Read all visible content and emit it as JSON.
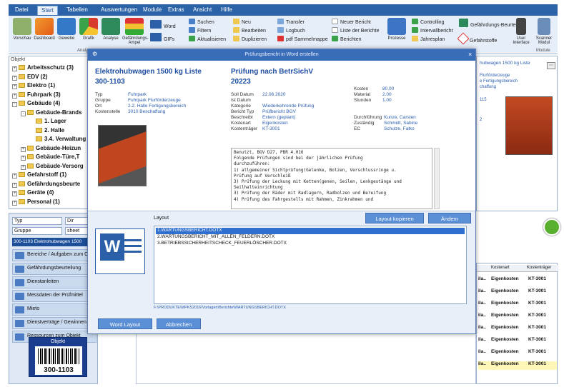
{
  "menubar": {
    "tabs": [
      "Datei",
      "Start",
      "Tabellen",
      "Auswertungen",
      "Module",
      "Extras",
      "Ansicht",
      "Hilfe"
    ],
    "active": "Start"
  },
  "ribbon": {
    "big_buttons": [
      {
        "label": "Vorschau",
        "icon": "preview-icon"
      },
      {
        "label": "Dashboard",
        "icon": "chart-icon"
      },
      {
        "label": "Gewebe",
        "icon": "network-icon"
      },
      {
        "label": "Grafik",
        "icon": "pie-icon"
      },
      {
        "label": "Analyse",
        "icon": "analyze-icon"
      },
      {
        "label": "Gefährdungs-Ampel",
        "icon": "traffic-icon"
      }
    ],
    "group_label_analysis": "Analysen",
    "col_buttons": [
      "Word",
      "GIFs"
    ],
    "small_col1": [
      "Suchen",
      "Filtern",
      "Aktualisieren"
    ],
    "small_col2": [
      "Neu",
      "Bearbeiten",
      "Duplizieren"
    ],
    "small_col3": [
      "Transfer",
      "Logbuch",
      "pdf Sammelmappe"
    ],
    "small_col4": [
      "Neuer Bericht",
      "Liste der Berichte",
      "Berichten"
    ],
    "process_label": "Prozesse",
    "small_col5": [
      "Controlling",
      "Intervallbericht",
      "Jahresplan"
    ],
    "small_col6": [
      "Gefährdungs-Beurteilung",
      "Gefahrstoffe"
    ],
    "group_label_module": "Module",
    "right_buttons": [
      "User Interface",
      "Scanner Modul"
    ]
  },
  "tree": {
    "header": "Objekt",
    "items": [
      {
        "label": "Arbeitsschutz (3)",
        "indent": 0,
        "sign": "+"
      },
      {
        "label": "EDV (2)",
        "indent": 0,
        "sign": "+"
      },
      {
        "label": "Elektro (1)",
        "indent": 0,
        "sign": "+"
      },
      {
        "label": "Fuhrpark (3)",
        "indent": 0,
        "sign": "+"
      },
      {
        "label": "Gebäude (4)",
        "indent": 0,
        "sign": "-"
      },
      {
        "label": "Gebäude-Brands",
        "indent": 1,
        "sign": "-"
      },
      {
        "label": "1. Lager",
        "indent": 2,
        "sign": ""
      },
      {
        "label": "2. Halle",
        "indent": 2,
        "sign": ""
      },
      {
        "label": "3.4. Verwaltung",
        "indent": 2,
        "sign": ""
      },
      {
        "label": "Gebäude-Heizun",
        "indent": 1,
        "sign": "+"
      },
      {
        "label": "Gebäude-Türe,T",
        "indent": 1,
        "sign": "+"
      },
      {
        "label": "Gebäude-Versorg",
        "indent": 1,
        "sign": "+"
      },
      {
        "label": "Gefahrstoff (1)",
        "indent": 0,
        "sign": "+"
      },
      {
        "label": "Gefährdungsbeurte",
        "indent": 0,
        "sign": "+"
      },
      {
        "label": "Geräte (4)",
        "indent": 0,
        "sign": "+"
      },
      {
        "label": "Personal (1)",
        "indent": 0,
        "sign": "+"
      }
    ]
  },
  "leftlow": {
    "select1": "Typ",
    "select1b": "Dir",
    "select2": "Gruppe",
    "select2b": "sheet",
    "selected_item": "300-1103 Elektrohubwagen 1500",
    "nav": [
      "Bereiche / Aufgaben zum O",
      "Gefährdungsbeurteilung",
      "Dienstanleiten",
      "Messdaten der Prüfmittel",
      "Mieto",
      "Dienstverträge / Gewinnen",
      "Ressourcen zum Objekt"
    ],
    "card_title": "Objekt",
    "card_number": "300-1103"
  },
  "modal": {
    "title": "Prüfungsbericht in Word erstellen",
    "object_title": "Elektrohubwagen 1500 kg Liste",
    "object_number": "300-1103",
    "object_fields": [
      {
        "k": "Typ",
        "v": "Fuhrpark"
      },
      {
        "k": "Gruppe",
        "v": "Fuhrpark Flurförderzeuge"
      },
      {
        "k": "Ort",
        "v": "2.2. Halle Fertigungsbereich"
      },
      {
        "k": "Kostenstelle",
        "v": "3010 Beschaffung"
      }
    ],
    "test_title": "Prüfung nach BetrSichV",
    "test_number": "20223",
    "test_fields": [
      {
        "k": "Soll Datum",
        "v": "22.06.2020"
      },
      {
        "k": "Ist Datum",
        "v": ""
      },
      {
        "k": "Kategorie",
        "v": "Wiederkehrende Prüfung"
      },
      {
        "k": "Bericht Typ",
        "v": "Prüfbericht BGV"
      },
      {
        "k": "Beschreibt",
        "v": "Extern (geplant)"
      },
      {
        "k": "Kostenart",
        "v": "Eigenkosten"
      },
      {
        "k": "Kostenträger",
        "v": "KT-3001"
      }
    ],
    "cost_fields": [
      {
        "k": "Kosten",
        "v": "80.00"
      },
      {
        "k": "Material",
        "v": "2.00"
      },
      {
        "k": "Stunden",
        "v": "1.00"
      }
    ],
    "resp_fields": [
      {
        "k": "Durchführung",
        "v": "Kunze, Carsten"
      },
      {
        "k": "Zuständig",
        "v": "Schmidt, Sabine"
      },
      {
        "k": "EC",
        "v": "Schulze, Falko"
      }
    ],
    "description": "Benutzt, BGV D27, PBR 4.016\nFolgende Prüfungen sind bei der jährlichen Prüfung\ndurchzuführen:\n1) allgemeiner Sichtprüfung(Gelenke, Bolzen, Verschlussringe u.\nPrüfung auf Verschleiß\n3) Prüfung der Leckung mit Ketten(genen, Seilen, Lenkgestänge und\nSeilhalteinrichtung\n3) Prüfung der Räder mit Radlagern, Radbolzen und Bereifung\n4) Prüfung des Fahrgestells mit Rahmen, Zinkrahmen und",
    "layout_label": "Layout",
    "layouts": [
      "1.WARTUNGSBERICHT.DOTX",
      "2.WARTUNGSBERICHT_MIT_ALLEN_FELDERN.DOTX",
      "3.BETRIEBSSICHERHEITSCHECK_FEUERLÖSCHER.DOTX"
    ],
    "active_layout": 0,
    "path_hint": "F:\\PRODUKTE\\MPKS2016\\Vorlagen\\Berichte\\WARTUNGSBERICHT.DOTX",
    "btn_copy": "Layout kopieren",
    "btn_edit": "Ändern",
    "btn_word": "Word Layout",
    "btn_cancel": "Abbrechen"
  },
  "rightpanel": {
    "header": "hubwagen 1500 kg Liste",
    "lines": [
      "Flurförderzeuge",
      "e Fertigungsbereich",
      "chaffung"
    ],
    "frag1": "115",
    "frag2": "2"
  },
  "rtable": {
    "headers": [
      "Kostenart",
      "Kostenträger"
    ],
    "rows": [
      {
        "a": "ila..",
        "b": "Eigenkosten",
        "c": "KT-3001"
      },
      {
        "a": "ila..",
        "b": "Eigenkosten",
        "c": "KT-3001"
      },
      {
        "a": "ila..",
        "b": "Eigenkosten",
        "c": "KT-3001"
      },
      {
        "a": "ila..",
        "b": "Eigenkosten",
        "c": "KT-3001"
      },
      {
        "a": "ila..",
        "b": "Eigenkosten",
        "c": "KT-3001"
      },
      {
        "a": "ila..",
        "b": "Eigenkosten",
        "c": "KT-3001"
      },
      {
        "a": "ila..",
        "b": "Eigenkosten",
        "c": "KT-3001"
      },
      {
        "a": "ila..",
        "b": "Eigenkosten",
        "c": "KT-3001"
      }
    ],
    "highlight_row": 7
  },
  "colors": {
    "accent": "#2c63a8",
    "selection": "#2f6fd0",
    "button": "#5b8fd6",
    "highlight": "#fff7b8"
  }
}
